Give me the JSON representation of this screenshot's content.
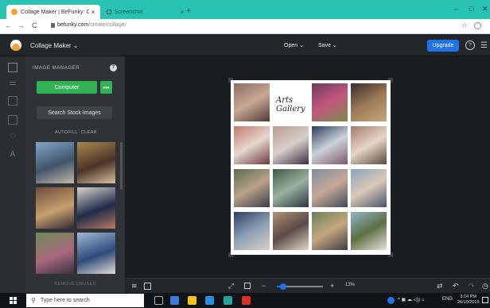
{
  "browser": {
    "tabs": [
      {
        "label": "Collage Maker | BeFunky: Create",
        "active": true
      },
      {
        "label": "Screenshot",
        "active": false
      }
    ],
    "new_tab": "+",
    "window_controls": {
      "minimize": "–",
      "maximize": "□",
      "close": "✕"
    },
    "nav": {
      "back": "←",
      "forward": "→",
      "reload": "C"
    },
    "address": {
      "host": "befunky.com",
      "path": "/create/collage/"
    },
    "bookmark": "☆"
  },
  "app": {
    "name": "Collage Maker ⌄",
    "menu": [
      {
        "label": "Open ⌄"
      },
      {
        "label": "Save ⌄"
      }
    ],
    "upgrade_label": "Upgrade",
    "help": "?",
    "menu_icon": "☰",
    "brand_colors": {
      "accent": "#1f72e8",
      "green": "#34b356",
      "chrome_tab": "#29c3b4",
      "logo": "#f6a12e"
    }
  },
  "rail_icons": [
    "image-manager-icon",
    "layout-icon",
    "grid-icon",
    "photo-icon",
    "heart-icon",
    "text-icon"
  ],
  "image_manager": {
    "title": "IMAGE MANAGER",
    "info": "?",
    "computer_label": "Computer",
    "more_label": "•••",
    "stock_label": "Search Stock Images",
    "autofill_label": "AUTOFILL",
    "clear_label": "CLEAR",
    "remove_unused_label": "REMOVE UNUSED",
    "thumbnails": [
      {
        "colors": [
          "#7fa6c9",
          "#42546a",
          "#c3b9a7"
        ]
      },
      {
        "colors": [
          "#a8894f",
          "#4a3328",
          "#d7c2a0"
        ]
      },
      {
        "colors": [
          "#6d4b3a",
          "#c7a06e",
          "#2f2a2f"
        ]
      },
      {
        "colors": [
          "#d8d3cf",
          "#1f2a4a",
          "#b77a63"
        ]
      },
      {
        "colors": [
          "#6b8b56",
          "#a9687d",
          "#3b3040"
        ]
      },
      {
        "colors": [
          "#9fb9d4",
          "#2f4a7a",
          "#e2ddd7"
        ]
      }
    ]
  },
  "collage": {
    "signature": "Arts Gallery",
    "cells": [
      {
        "colors": [
          "#8a6d63",
          "#c9a893",
          "#4d3a35"
        ]
      },
      {
        "colors": [
          "#ffffff",
          "#ffffff",
          "#ffffff"
        ],
        "signature": true
      },
      {
        "colors": [
          "#6a3c5a",
          "#c2577d",
          "#7a8a4a"
        ]
      },
      {
        "colors": [
          "#3a2a2a",
          "#9a7a58",
          "#c8a57a"
        ]
      },
      {
        "colors": [
          "#c27b6b",
          "#e6d7cf",
          "#6f3a3f"
        ]
      },
      {
        "colors": [
          "#b79c8f",
          "#d8cfcb",
          "#3c2f42"
        ]
      },
      {
        "colors": [
          "#2a3a5a",
          "#cdd2da",
          "#7b5a6d"
        ]
      },
      {
        "colors": [
          "#a4796a",
          "#e8d6c9",
          "#5a4a3a"
        ]
      },
      {
        "colors": [
          "#5b6a4f",
          "#b8a28a",
          "#3d3b47"
        ]
      },
      {
        "colors": [
          "#3d5a44",
          "#9bb0a0",
          "#2c3540"
        ]
      },
      {
        "colors": [
          "#7e8d9c",
          "#c6a898",
          "#3f4a57"
        ]
      },
      {
        "colors": [
          "#8ba3b8",
          "#d9c9b9",
          "#475468"
        ]
      },
      {
        "colors": [
          "#2c3e63",
          "#8d9fb5",
          "#d7d0c7"
        ]
      },
      {
        "colors": [
          "#b09174",
          "#5a4a46",
          "#e3d6c6"
        ]
      },
      {
        "colors": [
          "#6d7f5a",
          "#c4a77f",
          "#3f3a44"
        ]
      },
      {
        "colors": [
          "#92b4c9",
          "#5d6f44",
          "#e5e2da"
        ]
      }
    ]
  },
  "bottom_toolbar": {
    "zoom_minus": "−",
    "zoom_plus": "+",
    "zoom_value": "13%",
    "zoom_fraction": 0.13
  },
  "taskbar": {
    "search_placeholder": "Type here to search",
    "tray_lang": "ENG",
    "time": "3:14 PM",
    "date": "26/10/2019"
  }
}
